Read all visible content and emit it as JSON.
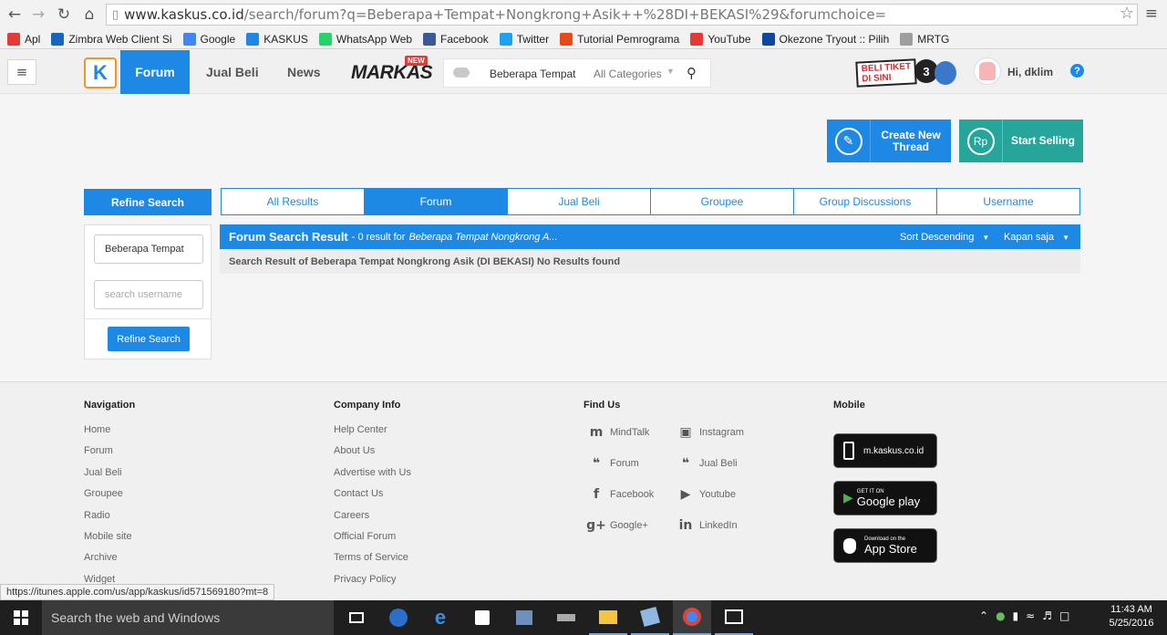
{
  "browser": {
    "url_host": "www.kaskus.co.id",
    "url_path": "/search/forum?q=Beberapa+Tempat+Nongkrong+Asik++%28DI+BEKASI%29&forumchoice=",
    "bookmarks": [
      {
        "label": "Apl",
        "icon": "apps-grid-icon",
        "color": "#e53935"
      },
      {
        "label": "Zimbra Web Client Si",
        "icon": "zimbra-icon",
        "color": "#1565c0"
      },
      {
        "label": "Google",
        "icon": "google-icon",
        "color": "#4285f4"
      },
      {
        "label": "KASKUS",
        "icon": "kaskus-icon",
        "color": "#1e88e5"
      },
      {
        "label": "WhatsApp Web",
        "icon": "whatsapp-icon",
        "color": "#25d366"
      },
      {
        "label": "Facebook",
        "icon": "facebook-icon",
        "color": "#3b5998"
      },
      {
        "label": "Twitter",
        "icon": "twitter-icon",
        "color": "#1da1f2"
      },
      {
        "label": "Tutorial Pemrograma",
        "icon": "code-icon",
        "color": "#e64a19"
      },
      {
        "label": "YouTube",
        "icon": "youtube-icon",
        "color": "#e53935"
      },
      {
        "label": "Okezone Tryout :: Pilih",
        "icon": "okezone-icon",
        "color": "#0d47a1"
      },
      {
        "label": "MRTG",
        "icon": "page-icon",
        "color": "#9e9e9e"
      }
    ]
  },
  "header": {
    "logo": "K",
    "nav": [
      "Forum",
      "Jual Beli",
      "News"
    ],
    "markas": "MARKAS",
    "markas_badge": "NEW",
    "search_query": "Beberapa Tempat",
    "search_category": "All Categories",
    "tiket_line1": "BELI TIKET",
    "tiket_line2": "DI SINI",
    "tiket_badge": "3",
    "greeting": "Hi, dklim",
    "help": "?"
  },
  "actions": {
    "create_thread": "Create New Thread",
    "start_selling": "Start Selling",
    "currency_symbol": "Rp"
  },
  "refine": {
    "header": "Refine Search",
    "query_value": "Beberapa Tempat",
    "username_placeholder": "search username",
    "button": "Refine Search"
  },
  "tabs": [
    {
      "label": "All Results",
      "active": false
    },
    {
      "label": "Forum",
      "active": true
    },
    {
      "label": "Jual Beli",
      "active": false
    },
    {
      "label": "Groupee",
      "active": false
    },
    {
      "label": "Group Discussions",
      "active": false
    },
    {
      "label": "Username",
      "active": false
    }
  ],
  "results": {
    "title": "Forum Search Result",
    "count_text": "- 0 result for",
    "query_excerpt": "Beberapa Tempat Nongkrong A...",
    "sort": "Sort Descending",
    "time": "Kapan saja",
    "message": "Search Result of Beberapa Tempat Nongkrong Asik (DI BEKASI) No Results found"
  },
  "footer": {
    "navigation": {
      "title": "Navigation",
      "links": [
        "Home",
        "Forum",
        "Jual Beli",
        "Groupee",
        "Radio",
        "Mobile site",
        "Archive",
        "Widget"
      ]
    },
    "company": {
      "title": "Company Info",
      "links": [
        "Help Center",
        "About Us",
        "Advertise with Us",
        "Contact Us",
        "Careers",
        "Official Forum",
        "Terms of Service",
        "Privacy Policy"
      ]
    },
    "find_us": {
      "title": "Find Us",
      "items": [
        "MindTalk",
        "Instagram",
        "Forum",
        "Jual Beli",
        "Facebook",
        "Youtube",
        "Google+",
        "LinkedIn"
      ]
    },
    "mobile": {
      "title": "Mobile",
      "site": "m.kaskus.co.id",
      "google_small": "GET IT ON",
      "google_big": "Google play",
      "apple_small": "Download on the",
      "apple_big": "App Store"
    }
  },
  "status_url": "https://itunes.apple.com/us/app/kaskus/id571569180?mt=8",
  "taskbar": {
    "search_placeholder": "Search the web and Windows",
    "time": "11:43 AM",
    "date": "5/25/2016"
  }
}
